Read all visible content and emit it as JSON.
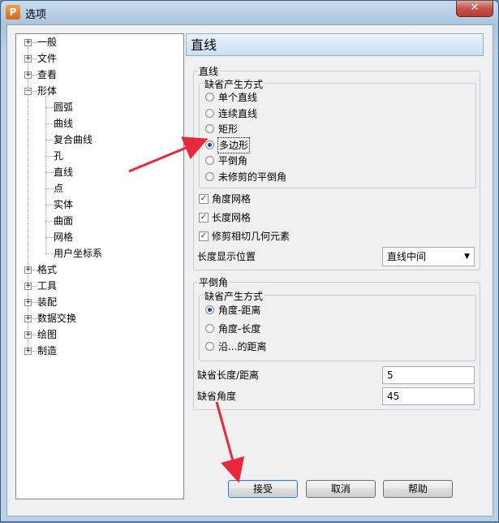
{
  "window": {
    "title": "选项",
    "app_icon_letter": "P",
    "close_glyph": "✕"
  },
  "tree": {
    "items": [
      {
        "label": "一般",
        "expander": "+",
        "level": 0
      },
      {
        "label": "文件",
        "expander": "+",
        "level": 0
      },
      {
        "label": "查看",
        "expander": "+",
        "level": 0
      },
      {
        "label": "形体",
        "expander": "−",
        "level": 0
      },
      {
        "label": "圆弧",
        "level": 1
      },
      {
        "label": "曲线",
        "level": 1
      },
      {
        "label": "复合曲线",
        "level": 1
      },
      {
        "label": "孔",
        "level": 1
      },
      {
        "label": "直线",
        "level": 1
      },
      {
        "label": "点",
        "level": 1
      },
      {
        "label": "实体",
        "level": 1
      },
      {
        "label": "曲面",
        "level": 1
      },
      {
        "label": "网格",
        "level": 1
      },
      {
        "label": "用户坐标系",
        "level": 1
      },
      {
        "label": "格式",
        "expander": "+",
        "level": 0
      },
      {
        "label": "工具",
        "expander": "+",
        "level": 0
      },
      {
        "label": "装配",
        "expander": "+",
        "level": 0
      },
      {
        "label": "数据交换",
        "expander": "+",
        "level": 0
      },
      {
        "label": "绘图",
        "expander": "+",
        "level": 0
      },
      {
        "label": "制造",
        "expander": "+",
        "level": 0
      }
    ]
  },
  "panel": {
    "header": "直线",
    "line_group": {
      "title": "直线",
      "method_group": {
        "title": "缺省产生方式",
        "options": [
          "单个直线",
          "连续直线",
          "矩形",
          "多边形",
          "平倒角",
          "未修剪的平倒角"
        ],
        "selected_index": 3
      },
      "checkboxes": [
        {
          "label": "角度网格",
          "checked": true
        },
        {
          "label": "长度网格",
          "checked": true
        },
        {
          "label": "修剪相切几何元素",
          "checked": true
        }
      ],
      "length_display_label": "长度显示位置",
      "length_display_value": "直线中间"
    },
    "chamfer_group": {
      "title": "平倒角",
      "method_group": {
        "title": "缺省产生方式",
        "options": [
          "角度-距离",
          "角度-长度",
          "沿...的距离"
        ],
        "selected_index": 0
      },
      "default_length_label": "缺省长度/距离",
      "default_length_value": "5",
      "default_angle_label": "缺省角度",
      "default_angle_value": "45"
    }
  },
  "buttons": {
    "accept": "接受",
    "cancel": "取消",
    "help": "帮助"
  },
  "colors": {
    "annotation_arrow": "#e8283c",
    "selected_radio": "#1f4f8f"
  }
}
